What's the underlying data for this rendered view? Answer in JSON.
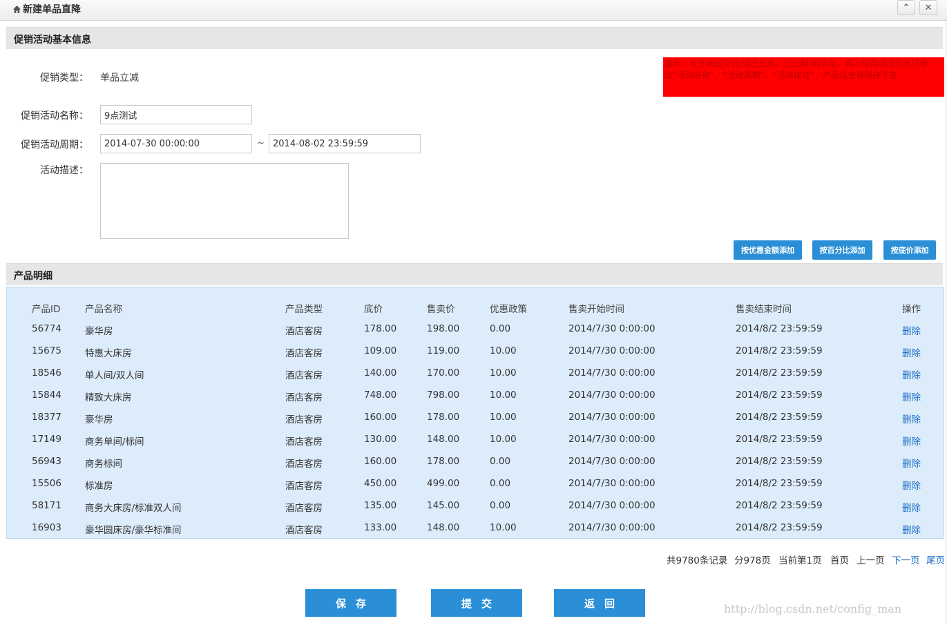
{
  "window": {
    "title": "新建单品直降",
    "icon": "home-icon",
    "collapse_icon": "chevron-up-icon",
    "close_icon": "close-icon",
    "collapse_label": "⌃",
    "close_label": "✕"
  },
  "basic_info": {
    "header": "促销活动基本信息",
    "type_label": "促销类型：",
    "type_value": "单品立减",
    "name_label": "促销活动名称：",
    "name_value": "9点测试",
    "period_label": "促销活动周期：",
    "start_value": "2014-07-30 00:00:00",
    "period_separator": "~",
    "end_value": "2014-08-02 23:59:59",
    "desc_label": "活动描述：",
    "desc_value": ""
  },
  "alert": {
    "text": "提示：对于被提交过(或已生效、已过期)的活动，再次保存或提交将只修改“活动名称”、“活动周期”、“活动描述”，产品信息将保持不变",
    "background": "#ff0000"
  },
  "add_buttons": {
    "by_amount": "按优惠金额添加",
    "by_percent": "按百分比添加",
    "by_base_price": "按底价添加"
  },
  "products": {
    "header": "产品明细",
    "columns": [
      "产品ID",
      "产品名称",
      "产品类型",
      "底价",
      "售卖价",
      "优惠政策",
      "售卖开始时间",
      "售卖结束时间",
      "操作"
    ],
    "rows": [
      [
        "56774",
        "豪华房",
        "酒店客房",
        "178.00",
        "198.00",
        "0.00",
        "2014/7/30 0:00:00",
        "2014/8/2 23:59:59",
        "删除"
      ],
      [
        "15675",
        "特惠大床房",
        "酒店客房",
        "109.00",
        "119.00",
        "10.00",
        "2014/7/30 0:00:00",
        "2014/8/2 23:59:59",
        "删除"
      ],
      [
        "18546",
        "单人间/双人间",
        "酒店客房",
        "140.00",
        "170.00",
        "10.00",
        "2014/7/30 0:00:00",
        "2014/8/2 23:59:59",
        "删除"
      ],
      [
        "15844",
        "精致大床房",
        "酒店客房",
        "748.00",
        "798.00",
        "10.00",
        "2014/7/30 0:00:00",
        "2014/8/2 23:59:59",
        "删除"
      ],
      [
        "18377",
        "豪华房",
        "酒店客房",
        "160.00",
        "178.00",
        "10.00",
        "2014/7/30 0:00:00",
        "2014/8/2 23:59:59",
        "删除"
      ],
      [
        "17149",
        "商务单间/标间",
        "酒店客房",
        "130.00",
        "148.00",
        "10.00",
        "2014/7/30 0:00:00",
        "2014/8/2 23:59:59",
        "删除"
      ],
      [
        "56943",
        "商务标间",
        "酒店客房",
        "160.00",
        "178.00",
        "0.00",
        "2014/7/30 0:00:00",
        "2014/8/2 23:59:59",
        "删除"
      ],
      [
        "15506",
        "标准房",
        "酒店客房",
        "450.00",
        "499.00",
        "0.00",
        "2014/7/30 0:00:00",
        "2014/8/2 23:59:59",
        "删除"
      ],
      [
        "58171",
        "商务大床房/标准双人间",
        "酒店客房",
        "135.00",
        "145.00",
        "0.00",
        "2014/7/30 0:00:00",
        "2014/8/2 23:59:59",
        "删除"
      ],
      [
        "16903",
        "豪华圆床房/豪华标准间",
        "酒店客房",
        "133.00",
        "148.00",
        "10.00",
        "2014/7/30 0:00:00",
        "2014/8/2 23:59:59",
        "删除"
      ]
    ]
  },
  "pagination": {
    "total": "共9780条记录",
    "pages": "分978页",
    "current": "当前第1页",
    "first": "首页",
    "prev": "上一页",
    "next": "下一页",
    "last": "尾页"
  },
  "actions": {
    "save": "保存",
    "submit": "提交",
    "back": "返回"
  },
  "watermark": "http://blog.csdn.net/config_man",
  "colors": {
    "accent": "#2a8fd6",
    "table_bg": "#dcecfb",
    "link": "#1f6fc4"
  }
}
